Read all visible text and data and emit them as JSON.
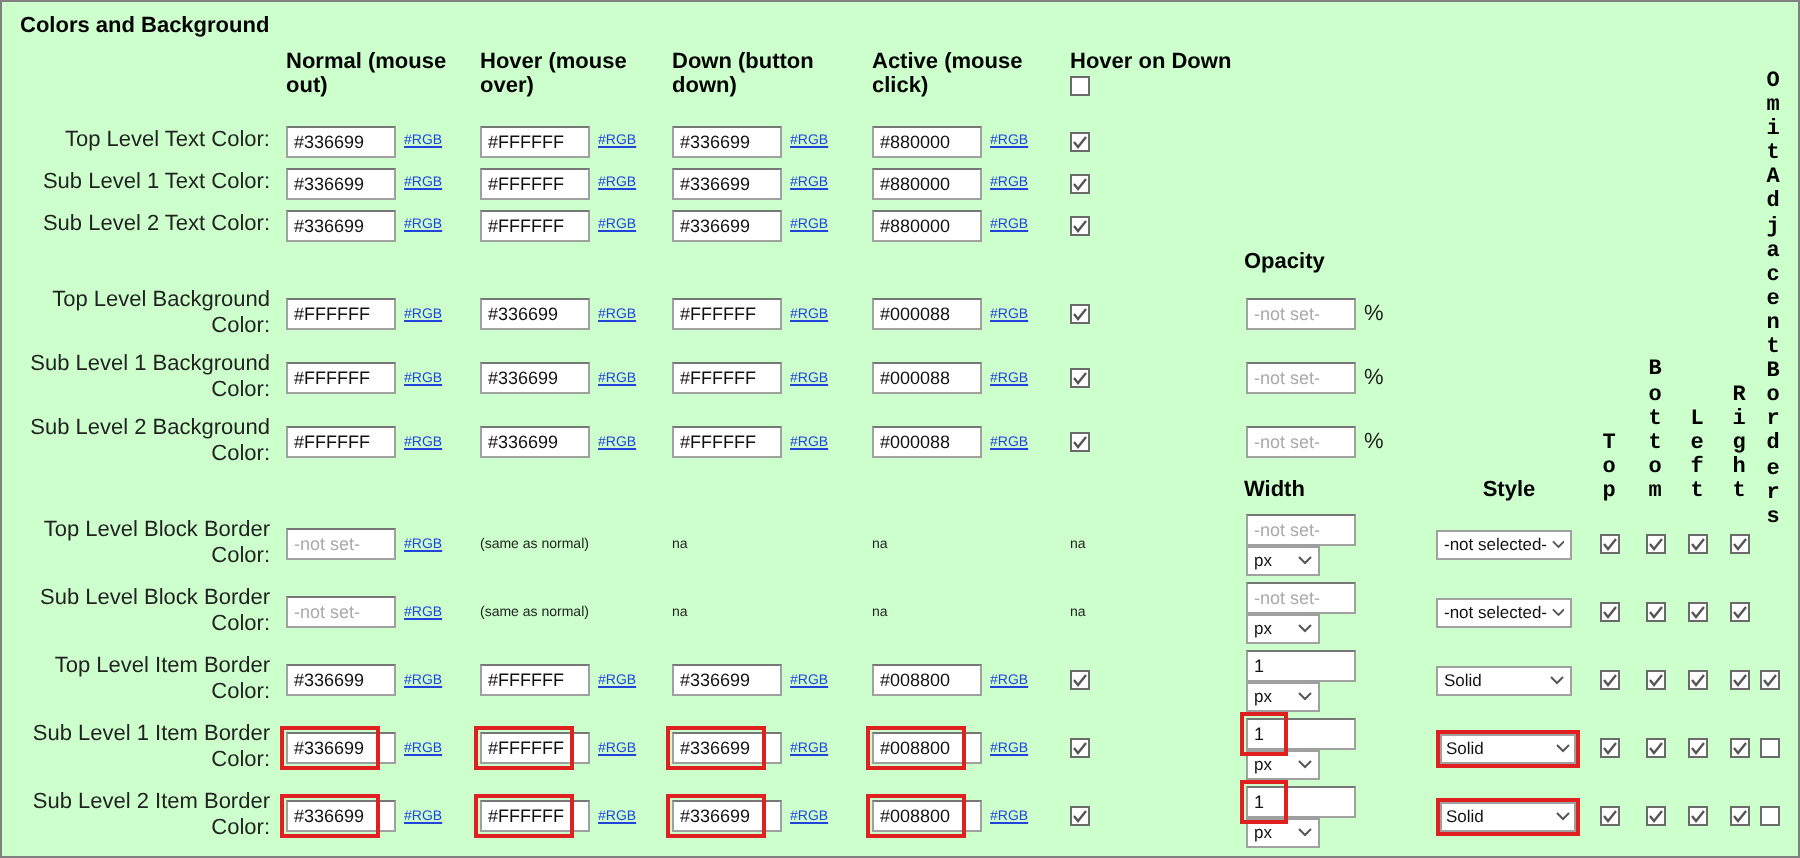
{
  "title": "Colors and Background",
  "columns": [
    {
      "label": "Normal (mouse out)"
    },
    {
      "label": "Hover (mouse over)"
    },
    {
      "label": "Down (button down)"
    },
    {
      "label": "Active (mouse click)"
    },
    {
      "label": "Hover on Down",
      "checked": false
    }
  ],
  "opacity_header": "Opacity",
  "width_header": "Width",
  "style_header": "Style",
  "side_headers": [
    "Top",
    "Bottom",
    "Left",
    "Right"
  ],
  "omit_header": "Omit Adjacent Borders",
  "rows": [
    {
      "kind": "text",
      "label": "Top Level Text Color:",
      "cells": [
        {
          "kind": "color",
          "value": "#336699",
          "link": "#RGB",
          "highlighted": false
        },
        {
          "kind": "color",
          "value": "#FFFFFF",
          "link": "#RGB",
          "highlighted": false
        },
        {
          "kind": "color",
          "value": "#336699",
          "link": "#RGB",
          "highlighted": false
        },
        {
          "kind": "color",
          "value": "#880000",
          "link": "#RGB",
          "highlighted": false
        },
        {
          "kind": "checkbox",
          "checked": true
        }
      ]
    },
    {
      "kind": "text",
      "label": "Sub Level 1 Text Color:",
      "cells": [
        {
          "kind": "color",
          "value": "#336699",
          "link": "#RGB",
          "highlighted": false
        },
        {
          "kind": "color",
          "value": "#FFFFFF",
          "link": "#RGB",
          "highlighted": false
        },
        {
          "kind": "color",
          "value": "#336699",
          "link": "#RGB",
          "highlighted": false
        },
        {
          "kind": "color",
          "value": "#880000",
          "link": "#RGB",
          "highlighted": false
        },
        {
          "kind": "checkbox",
          "checked": true
        }
      ]
    },
    {
      "kind": "text",
      "label": "Sub Level 2 Text Color:",
      "cells": [
        {
          "kind": "color",
          "value": "#336699",
          "link": "#RGB",
          "highlighted": false
        },
        {
          "kind": "color",
          "value": "#FFFFFF",
          "link": "#RGB",
          "highlighted": false
        },
        {
          "kind": "color",
          "value": "#336699",
          "link": "#RGB",
          "highlighted": false
        },
        {
          "kind": "color",
          "value": "#880000",
          "link": "#RGB",
          "highlighted": false
        },
        {
          "kind": "checkbox",
          "checked": true
        }
      ]
    },
    {
      "kind": "background",
      "label": "Top Level Background Color:",
      "cells": [
        {
          "kind": "color",
          "value": "#FFFFFF",
          "link": "#RGB",
          "highlighted": false
        },
        {
          "kind": "color",
          "value": "#336699",
          "link": "#RGB",
          "highlighted": false
        },
        {
          "kind": "color",
          "value": "#FFFFFF",
          "link": "#RGB",
          "highlighted": false
        },
        {
          "kind": "color",
          "value": "#000088",
          "link": "#RGB",
          "highlighted": false
        },
        {
          "kind": "checkbox",
          "checked": true
        }
      ],
      "opacity": {
        "placeholder": "-not set-",
        "unit": "%"
      }
    },
    {
      "kind": "background",
      "label": "Sub Level 1 Background Color:",
      "cells": [
        {
          "kind": "color",
          "value": "#FFFFFF",
          "link": "#RGB",
          "highlighted": false
        },
        {
          "kind": "color",
          "value": "#336699",
          "link": "#RGB",
          "highlighted": false
        },
        {
          "kind": "color",
          "value": "#FFFFFF",
          "link": "#RGB",
          "highlighted": false
        },
        {
          "kind": "color",
          "value": "#000088",
          "link": "#RGB",
          "highlighted": false
        },
        {
          "kind": "checkbox",
          "checked": true
        }
      ],
      "opacity": {
        "placeholder": "-not set-",
        "unit": "%"
      }
    },
    {
      "kind": "background",
      "label": "Sub Level 2 Background Color:",
      "cells": [
        {
          "kind": "color",
          "value": "#FFFFFF",
          "link": "#RGB",
          "highlighted": false
        },
        {
          "kind": "color",
          "value": "#336699",
          "link": "#RGB",
          "highlighted": false
        },
        {
          "kind": "color",
          "value": "#FFFFFF",
          "link": "#RGB",
          "highlighted": false
        },
        {
          "kind": "color",
          "value": "#000088",
          "link": "#RGB",
          "highlighted": false
        },
        {
          "kind": "checkbox",
          "checked": true
        }
      ],
      "opacity": {
        "placeholder": "-not set-",
        "unit": "%"
      }
    },
    {
      "kind": "border",
      "label": "Top Level Block Border Color:",
      "cells": [
        {
          "kind": "color",
          "placeholder": "-not set-",
          "link": "#RGB",
          "highlighted": false
        },
        {
          "kind": "note",
          "text": "(same as normal)"
        },
        {
          "kind": "note",
          "text": "na"
        },
        {
          "kind": "note",
          "text": "na"
        },
        {
          "kind": "note",
          "text": "na"
        }
      ],
      "width": {
        "placeholder": "-not set-",
        "unit": "px",
        "highlighted": false
      },
      "style": {
        "value": "-not selected-",
        "highlighted": false
      },
      "sides": [
        true,
        true,
        true,
        true
      ]
    },
    {
      "kind": "border",
      "label": "Sub Level Block Border Color:",
      "cells": [
        {
          "kind": "color",
          "placeholder": "-not set-",
          "link": "#RGB",
          "highlighted": false
        },
        {
          "kind": "note",
          "text": "(same as normal)"
        },
        {
          "kind": "note",
          "text": "na"
        },
        {
          "kind": "note",
          "text": "na"
        },
        {
          "kind": "note",
          "text": "na"
        }
      ],
      "width": {
        "placeholder": "-not set-",
        "unit": "px",
        "highlighted": false
      },
      "style": {
        "value": "-not selected-",
        "highlighted": false
      },
      "sides": [
        true,
        true,
        true,
        true
      ]
    },
    {
      "kind": "border",
      "label": "Top Level Item Border Color:",
      "cells": [
        {
          "kind": "color",
          "value": "#336699",
          "link": "#RGB",
          "highlighted": false
        },
        {
          "kind": "color",
          "value": "#FFFFFF",
          "link": "#RGB",
          "highlighted": false
        },
        {
          "kind": "color",
          "value": "#336699",
          "link": "#RGB",
          "highlighted": false
        },
        {
          "kind": "color",
          "value": "#008800",
          "link": "#RGB",
          "highlighted": false
        },
        {
          "kind": "checkbox",
          "checked": true
        }
      ],
      "width": {
        "value": "1",
        "unit": "px",
        "highlighted": false
      },
      "style": {
        "value": "Solid",
        "highlighted": false
      },
      "sides": [
        true,
        true,
        true,
        true
      ],
      "omit": true
    },
    {
      "kind": "border",
      "label": "Sub Level 1 Item Border Color:",
      "cells": [
        {
          "kind": "color",
          "value": "#336699",
          "link": "#RGB",
          "highlighted": true
        },
        {
          "kind": "color",
          "value": "#FFFFFF",
          "link": "#RGB",
          "highlighted": true
        },
        {
          "kind": "color",
          "value": "#336699",
          "link": "#RGB",
          "highlighted": true
        },
        {
          "kind": "color",
          "value": "#008800",
          "link": "#RGB",
          "highlighted": true
        },
        {
          "kind": "checkbox",
          "checked": true
        }
      ],
      "width": {
        "value": "1",
        "unit": "px",
        "highlighted": true
      },
      "style": {
        "value": "Solid",
        "highlighted": true
      },
      "sides": [
        true,
        true,
        true,
        true
      ],
      "omit": false
    },
    {
      "kind": "border",
      "label": "Sub Level 2 Item Border Color:",
      "cells": [
        {
          "kind": "color",
          "value": "#336699",
          "link": "#RGB",
          "highlighted": true
        },
        {
          "kind": "color",
          "value": "#FFFFFF",
          "link": "#RGB",
          "highlighted": true
        },
        {
          "kind": "color",
          "value": "#336699",
          "link": "#RGB",
          "highlighted": true
        },
        {
          "kind": "color",
          "value": "#008800",
          "link": "#RGB",
          "highlighted": true
        },
        {
          "kind": "checkbox",
          "checked": true
        }
      ],
      "width": {
        "value": "1",
        "unit": "px",
        "highlighted": true
      },
      "style": {
        "value": "Solid",
        "highlighted": true
      },
      "sides": [
        true,
        true,
        true,
        true
      ],
      "omit": false
    }
  ]
}
